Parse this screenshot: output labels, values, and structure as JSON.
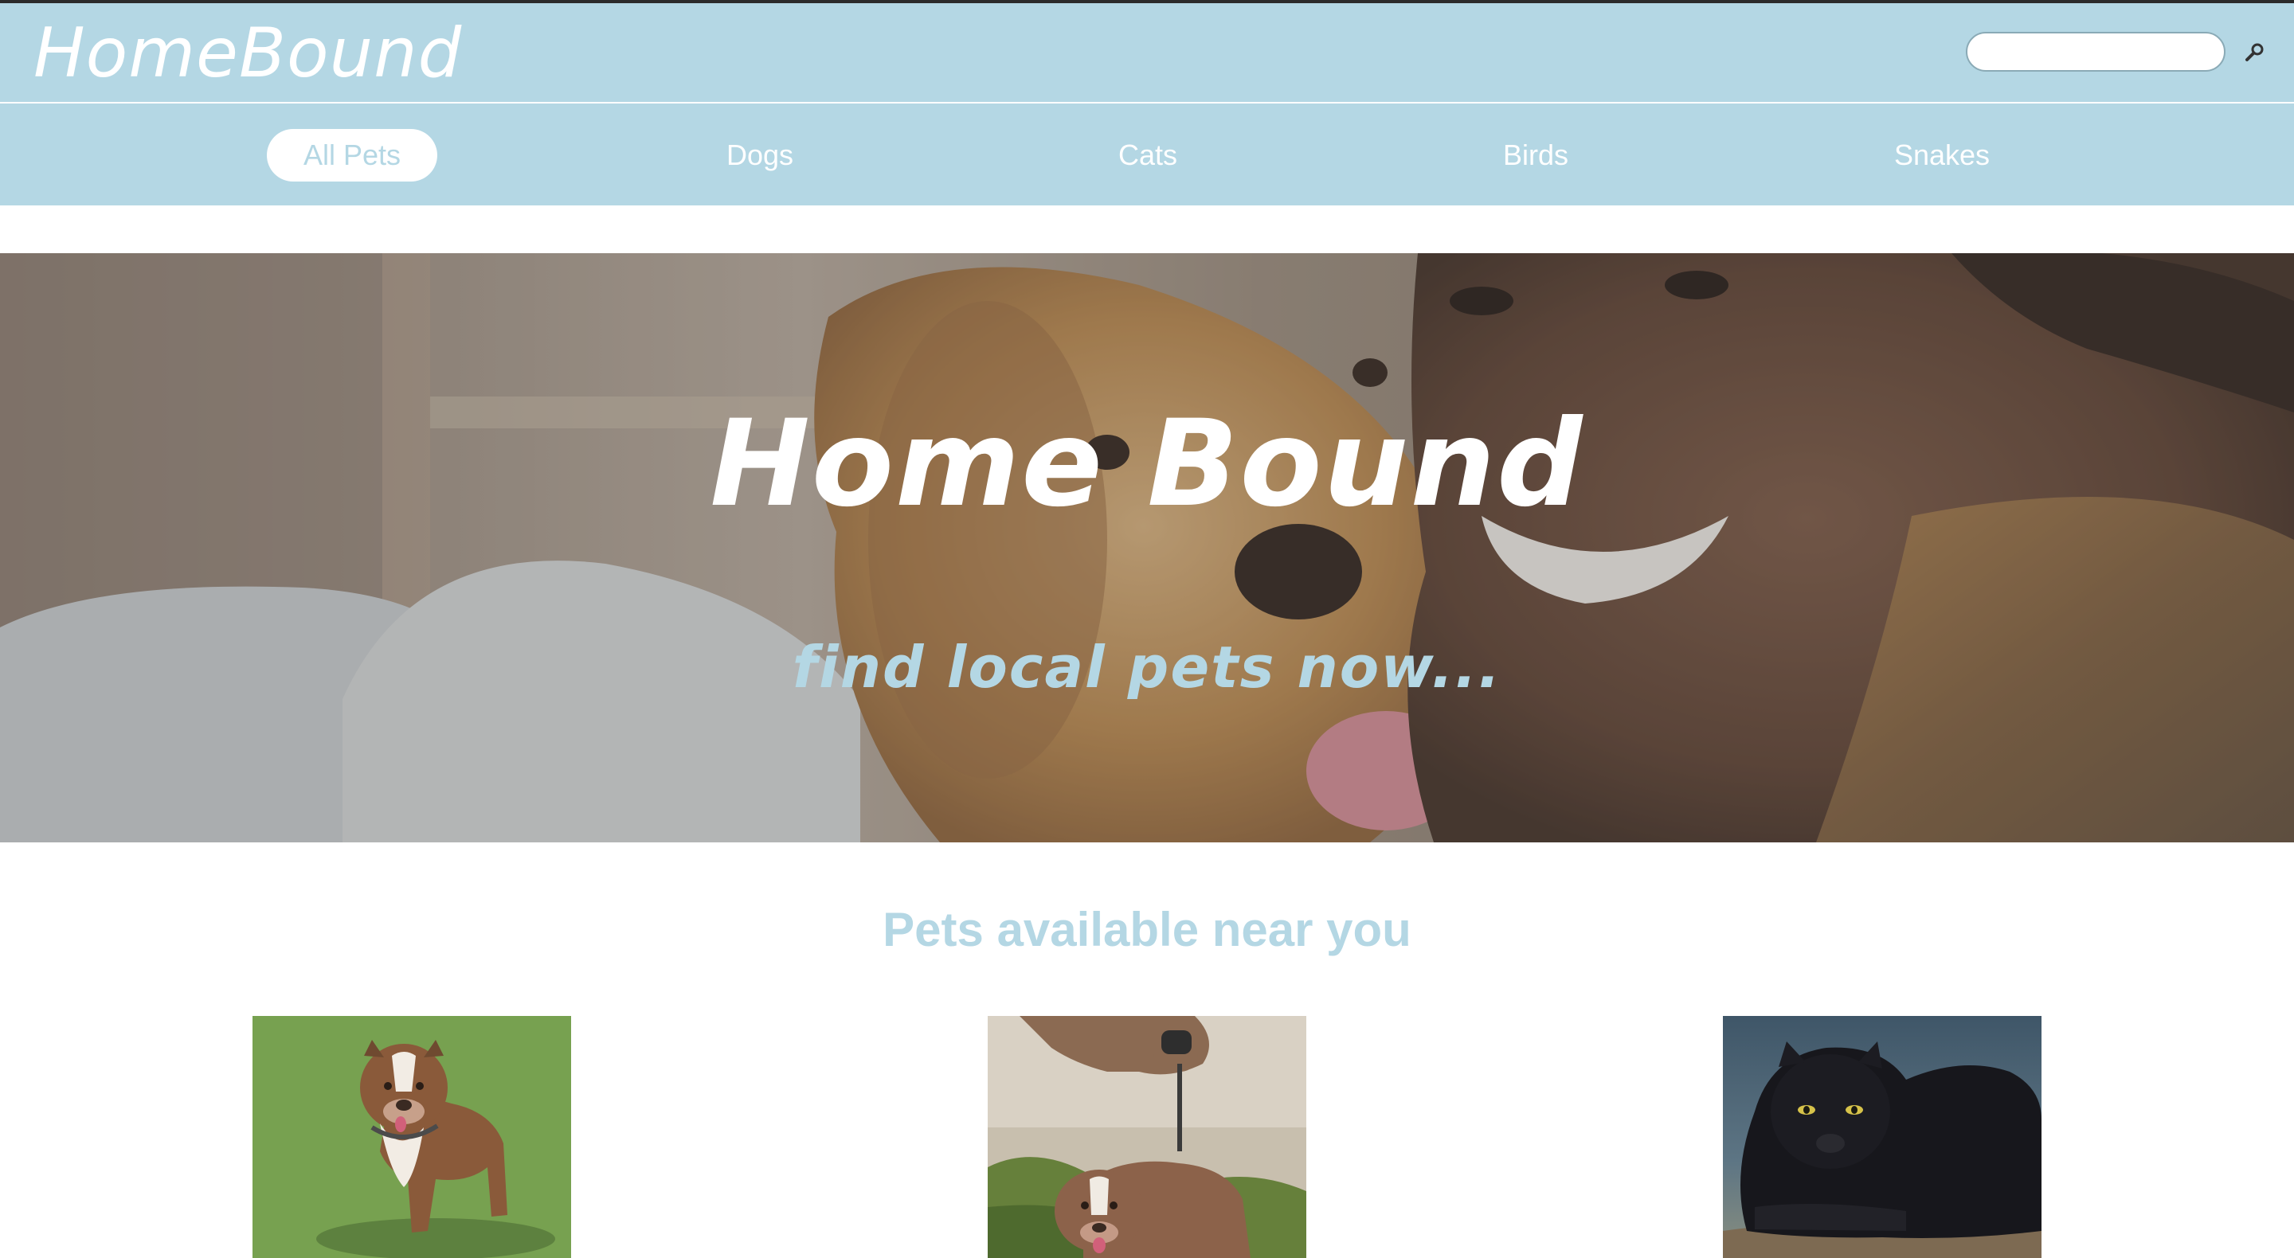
{
  "header": {
    "logo": "HomeBound",
    "search": {
      "value": "",
      "placeholder": ""
    },
    "search_icon": "search-icon"
  },
  "nav": {
    "items": [
      {
        "label": "All Pets",
        "active": true
      },
      {
        "label": "Dogs",
        "active": false
      },
      {
        "label": "Cats",
        "active": false
      },
      {
        "label": "Birds",
        "active": false
      },
      {
        "label": "Snakes",
        "active": false
      }
    ]
  },
  "hero": {
    "title": "Home Bound",
    "subtitle": "find local pets now..."
  },
  "pets_section": {
    "title": "Pets available near you",
    "cards": [
      {
        "image": "brown-pit-bull-on-grass"
      },
      {
        "image": "two-dogs-on-rocky-beach"
      },
      {
        "image": "black-panther-on-rock"
      }
    ]
  },
  "colors": {
    "accent": "#b4d7e4",
    "header_bg": "#b4d7e4",
    "text_light": "#ffffff"
  }
}
